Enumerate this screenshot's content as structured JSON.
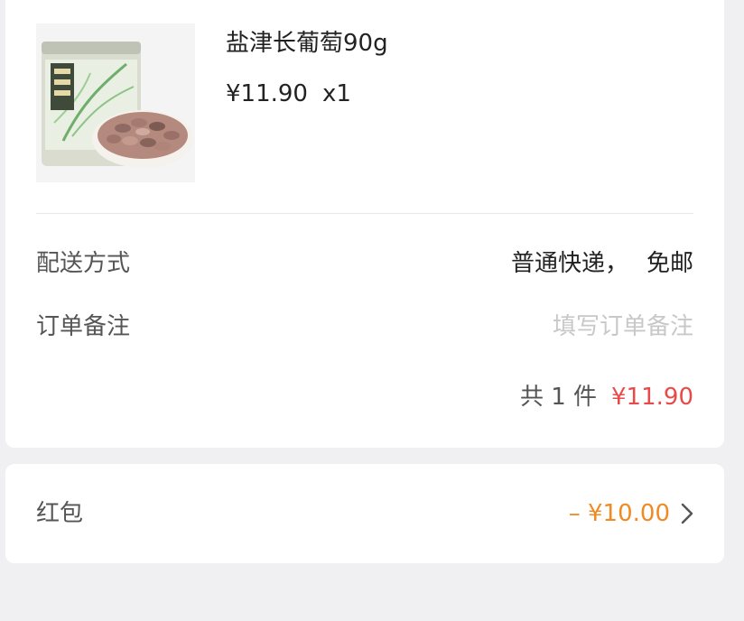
{
  "product": {
    "name": "盐津长葡萄90g",
    "price": "¥11.90",
    "quantity": "x1",
    "image_icon": "raisin-jar-product-image"
  },
  "shipping": {
    "label": "配送方式",
    "method": "普通快递，",
    "fee": "免邮"
  },
  "order_note": {
    "label": "订单备注",
    "placeholder": "填写订单备注",
    "value": ""
  },
  "summary": {
    "count_text": "共 1 件",
    "total": "¥11.90"
  },
  "red_packet": {
    "label": "红包",
    "value": "– ¥10.00",
    "icon": "chevron-right-icon"
  },
  "colors": {
    "total_red": "#e84a4a",
    "discount_orange": "#f08a24",
    "page_bg": "#f0f0f2",
    "card_bg": "#ffffff"
  }
}
